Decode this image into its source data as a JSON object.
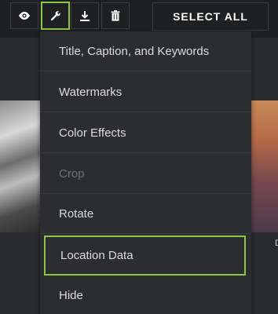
{
  "toolbar": {
    "select_all_label": "SELECT ALL",
    "buttons": [
      {
        "icon": "eye-icon"
      },
      {
        "icon": "wrench-icon",
        "active": true
      },
      {
        "icon": "download-icon"
      },
      {
        "icon": "trash-icon"
      }
    ]
  },
  "menu": {
    "items": [
      {
        "label": "Title, Caption, and Keywords"
      },
      {
        "label": "Watermarks"
      },
      {
        "label": "Color Effects"
      },
      {
        "label": "Crop",
        "disabled": true
      },
      {
        "label": "Rotate"
      },
      {
        "label": "Location Data",
        "highlighted": true
      },
      {
        "label": "Hide"
      }
    ]
  },
  "thumbnail": {
    "label_fragment": "D"
  },
  "colors": {
    "accent": "#8cc63f",
    "background": "#1f2022",
    "menu_bg": "#2c2d30"
  }
}
